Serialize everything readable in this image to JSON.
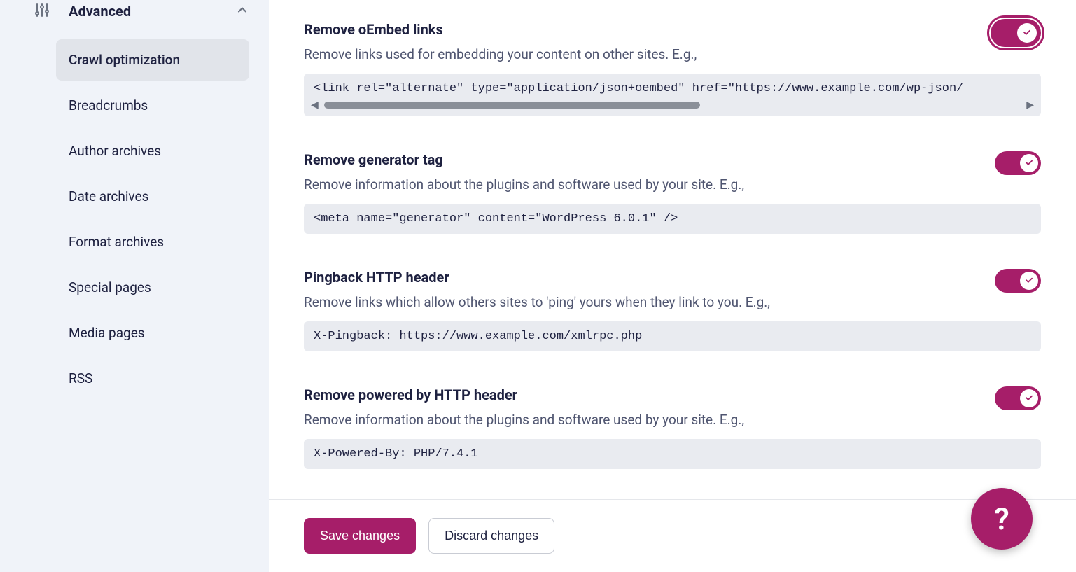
{
  "sidebar": {
    "section_title": "Advanced",
    "items": [
      {
        "label": "Crawl optimization",
        "active": true
      },
      {
        "label": "Breadcrumbs",
        "active": false
      },
      {
        "label": "Author archives",
        "active": false
      },
      {
        "label": "Date archives",
        "active": false
      },
      {
        "label": "Format archives",
        "active": false
      },
      {
        "label": "Special pages",
        "active": false
      },
      {
        "label": "Media pages",
        "active": false
      },
      {
        "label": "RSS",
        "active": false
      }
    ]
  },
  "settings": [
    {
      "title": "Remove oEmbed links",
      "description": "Remove links used for embedding your content on other sites. E.g.,",
      "code": "<link rel=\"alternate\" type=\"application/json+oembed\" href=\"https://www.example.com/wp-json/",
      "toggle_on": true,
      "focused": true,
      "has_scrollbar": true
    },
    {
      "title": "Remove generator tag",
      "description": "Remove information about the plugins and software used by your site. E.g.,",
      "code": "<meta name=\"generator\" content=\"WordPress 6.0.1\" />",
      "toggle_on": true,
      "focused": false,
      "has_scrollbar": false
    },
    {
      "title": "Pingback HTTP header",
      "description": "Remove links which allow others sites to 'ping' yours when they link to you. E.g.,",
      "code": "X-Pingback: https://www.example.com/xmlrpc.php",
      "toggle_on": true,
      "focused": false,
      "has_scrollbar": false
    },
    {
      "title": "Remove powered by HTTP header",
      "description": "Remove information about the plugins and software used by your site. E.g.,",
      "code": "X-Powered-By: PHP/7.4.1",
      "toggle_on": true,
      "focused": false,
      "has_scrollbar": false
    }
  ],
  "footer": {
    "save_label": "Save changes",
    "discard_label": "Discard changes"
  },
  "help_label": "?"
}
